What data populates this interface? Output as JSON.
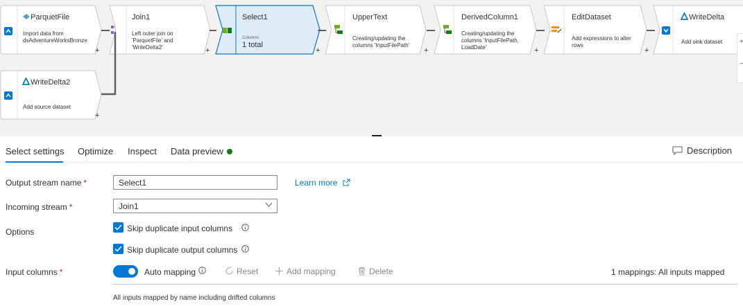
{
  "flow": {
    "nodes": [
      {
        "title": "ParquetFile",
        "desc": "Import data from dsAdventureWorksBronze",
        "icon": "parquet-icon"
      },
      {
        "title": "Join1",
        "desc": "Left outer join on 'ParquetFile' and 'WriteDelta2'",
        "icon": "join-icon"
      },
      {
        "title": "Select1",
        "desc_small": "Columns:",
        "desc": "1 total",
        "icon": "select-icon"
      },
      {
        "title": "UpperText",
        "desc": "Creating/updating the columns 'InputFilePath'",
        "icon": "derived-column-icon"
      },
      {
        "title": "DerivedColumn1",
        "desc": "Creating/updating the columns 'InputFilePath, LoadDate'",
        "icon": "derived-column-icon"
      },
      {
        "title": "EditDataset",
        "desc": "Add expressions to alter rows",
        "icon": "alter-row-icon"
      },
      {
        "title": "WriteDelta",
        "desc": "Add sink dataset",
        "icon": "delta-icon"
      },
      {
        "title": "WriteDelta2",
        "desc": "Add source dataset",
        "icon": "delta-icon"
      }
    ],
    "plus": "+"
  },
  "tabs": [
    "Select settings",
    "Optimize",
    "Inspect",
    "Data preview"
  ],
  "description_button": "Description",
  "form": {
    "output_stream_label": "Output stream name",
    "output_stream_value": "Select1",
    "incoming_stream_label": "Incoming stream",
    "incoming_stream_value": "Join1",
    "learn_more": "Learn more",
    "options_label": "Options",
    "skip_input": "Skip duplicate input columns",
    "skip_output": "Skip duplicate output columns",
    "input_columns_label": "Input columns",
    "auto_mapping": "Auto mapping",
    "reset": "Reset",
    "add_mapping": "Add mapping",
    "delete": "Delete",
    "mappings_status": "1 mappings: All inputs mapped",
    "mapped_note": "All inputs mapped by name including drifted columns",
    "required_mark": "*"
  },
  "colors": {
    "accent": "#0078d4",
    "selected_node": "#deecf9",
    "data_preview_dot": "#107c10"
  }
}
